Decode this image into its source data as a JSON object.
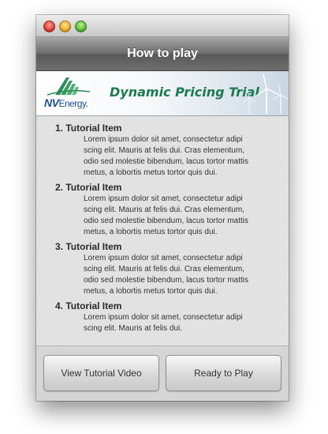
{
  "window": {
    "controls": [
      "close",
      "minimize",
      "zoom"
    ]
  },
  "header": {
    "title": "How to play"
  },
  "banner": {
    "logo_nv": "NV",
    "logo_energy": "Energy",
    "logo_dot": ".",
    "title": "Dynamic Pricing Trial"
  },
  "tutorial": {
    "items": [
      {
        "title": "1. Tutorial Item",
        "body": "Lorem ipsum dolor sit amet, consectetur adipi scing elit. Mauris at felis dui. Cras elementum, odio sed molestie bibendum, lacus tortor mattis metus, a lobortis metus tortor quis dui."
      },
      {
        "title": "2. Tutorial Item",
        "body": "Lorem ipsum dolor sit amet, consectetur adipi scing elit. Mauris at felis dui. Cras elementum, odio sed molestie bibendum, lacus tortor mattis metus, a lobortis metus tortor quis dui."
      },
      {
        "title": "3. Tutorial Item",
        "body": "Lorem ipsum dolor sit amet, consectetur adipi scing elit. Mauris at felis dui. Cras elementum, odio sed molestie bibendum, lacus tortor mattis metus, a lobortis metus tortor quis dui."
      },
      {
        "title": "4. Tutorial Item",
        "body": "Lorem ipsum dolor sit amet, consectetur adipi scing elit. Mauris at felis dui."
      }
    ]
  },
  "footer": {
    "video_button_label": "View Tutorial Video",
    "play_button_label": "Ready to Play"
  },
  "colors": {
    "header_gradient_top": "#a7a7a7",
    "header_gradient_bottom": "#595959",
    "banner_title": "#1c7a52",
    "logo_blue": "#1a4f8c",
    "logo_green": "#2e8b57"
  }
}
